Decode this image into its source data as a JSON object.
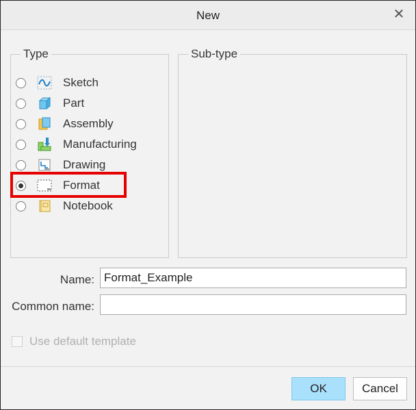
{
  "window": {
    "title": "New",
    "close_glyph": "✕"
  },
  "type_group": {
    "legend": "Type",
    "selected": "Format",
    "options": [
      {
        "label": "Sketch",
        "icon": "sketch-icon",
        "checked": false
      },
      {
        "label": "Part",
        "icon": "part-icon",
        "checked": false
      },
      {
        "label": "Assembly",
        "icon": "assembly-icon",
        "checked": false
      },
      {
        "label": "Manufacturing",
        "icon": "manufacturing-icon",
        "checked": false
      },
      {
        "label": "Drawing",
        "icon": "drawing-icon",
        "checked": false
      },
      {
        "label": "Format",
        "icon": "format-icon",
        "checked": true
      },
      {
        "label": "Notebook",
        "icon": "notebook-icon",
        "checked": false
      }
    ]
  },
  "subtype_group": {
    "legend": "Sub-type"
  },
  "fields": {
    "name_label": "Name:",
    "name_value": "Format_Example",
    "common_name_label": "Common name:",
    "common_name_value": ""
  },
  "options": {
    "use_default_template_label": "Use default template",
    "use_default_template_checked": false,
    "use_default_template_enabled": false
  },
  "buttons": {
    "ok_label": "OK",
    "cancel_label": "Cancel"
  },
  "colors": {
    "highlight": "#e60000",
    "ok_button": "#a9e0fb"
  }
}
